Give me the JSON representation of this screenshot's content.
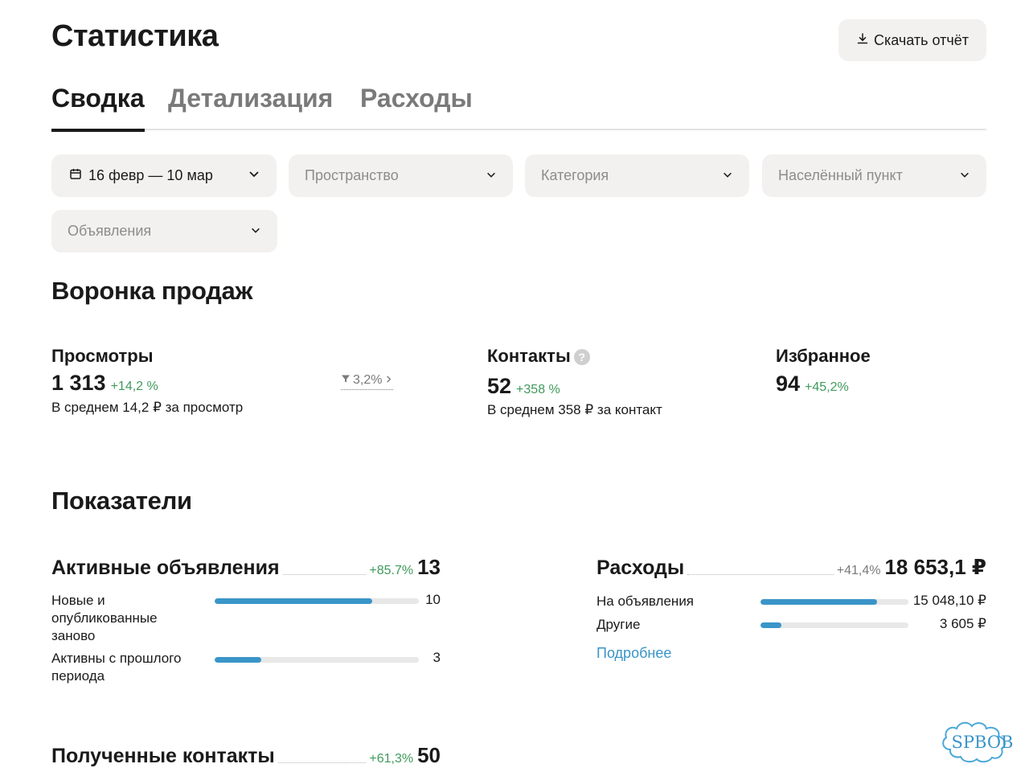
{
  "header": {
    "title": "Статистика",
    "download_label": "Скачать отчёт"
  },
  "tabs": [
    {
      "label": "Сводка",
      "active": true
    },
    {
      "label": "Детализация",
      "active": false
    },
    {
      "label": "Расходы",
      "active": false
    }
  ],
  "filters": {
    "date": "16 февр — 10 мар",
    "space": "Пространство",
    "category": "Категория",
    "locality": "Населённый пункт",
    "ads": "Объявления"
  },
  "funnel": {
    "title": "Воронка продаж",
    "views": {
      "label": "Просмотры",
      "value": "1 313",
      "delta": "+14,2 %",
      "sub": "В среднем 14,2 ₽ за просмотр"
    },
    "conversion": "3,2%",
    "contacts": {
      "label": "Контакты",
      "value": "52",
      "delta": "+358 %",
      "sub": "В среднем 358 ₽ за контакт",
      "help": "?"
    },
    "favorites": {
      "label": "Избранное",
      "value": "94",
      "delta": "+45,2%"
    }
  },
  "metrics": {
    "title": "Показатели",
    "active_ads": {
      "label": "Активные объявления",
      "delta": "+85.7%",
      "value": "13",
      "rows": [
        {
          "label": "Новые и опубликованные заново",
          "value": "10",
          "fill": 0.77
        },
        {
          "label": "Активны с прошлого периода",
          "value": "3",
          "fill": 0.23
        }
      ]
    },
    "expenses": {
      "label": "Расходы",
      "delta": "+41,4%",
      "value": "18 653,1 ₽",
      "rows": [
        {
          "label": "На объявления",
          "value": "15 048,10 ₽",
          "fill": 0.79
        },
        {
          "label": "Другие",
          "value": "3 605 ₽",
          "fill": 0.14
        }
      ],
      "more_link": "Подробнее"
    },
    "contacts_received": {
      "label": "Полученные контакты",
      "delta": "+61,3%",
      "value": "50"
    }
  },
  "watermark": "SPBOB",
  "colors": {
    "accent": "#3a95c8",
    "positive": "#3f9a5c",
    "chip_bg": "#f2f1ef"
  }
}
